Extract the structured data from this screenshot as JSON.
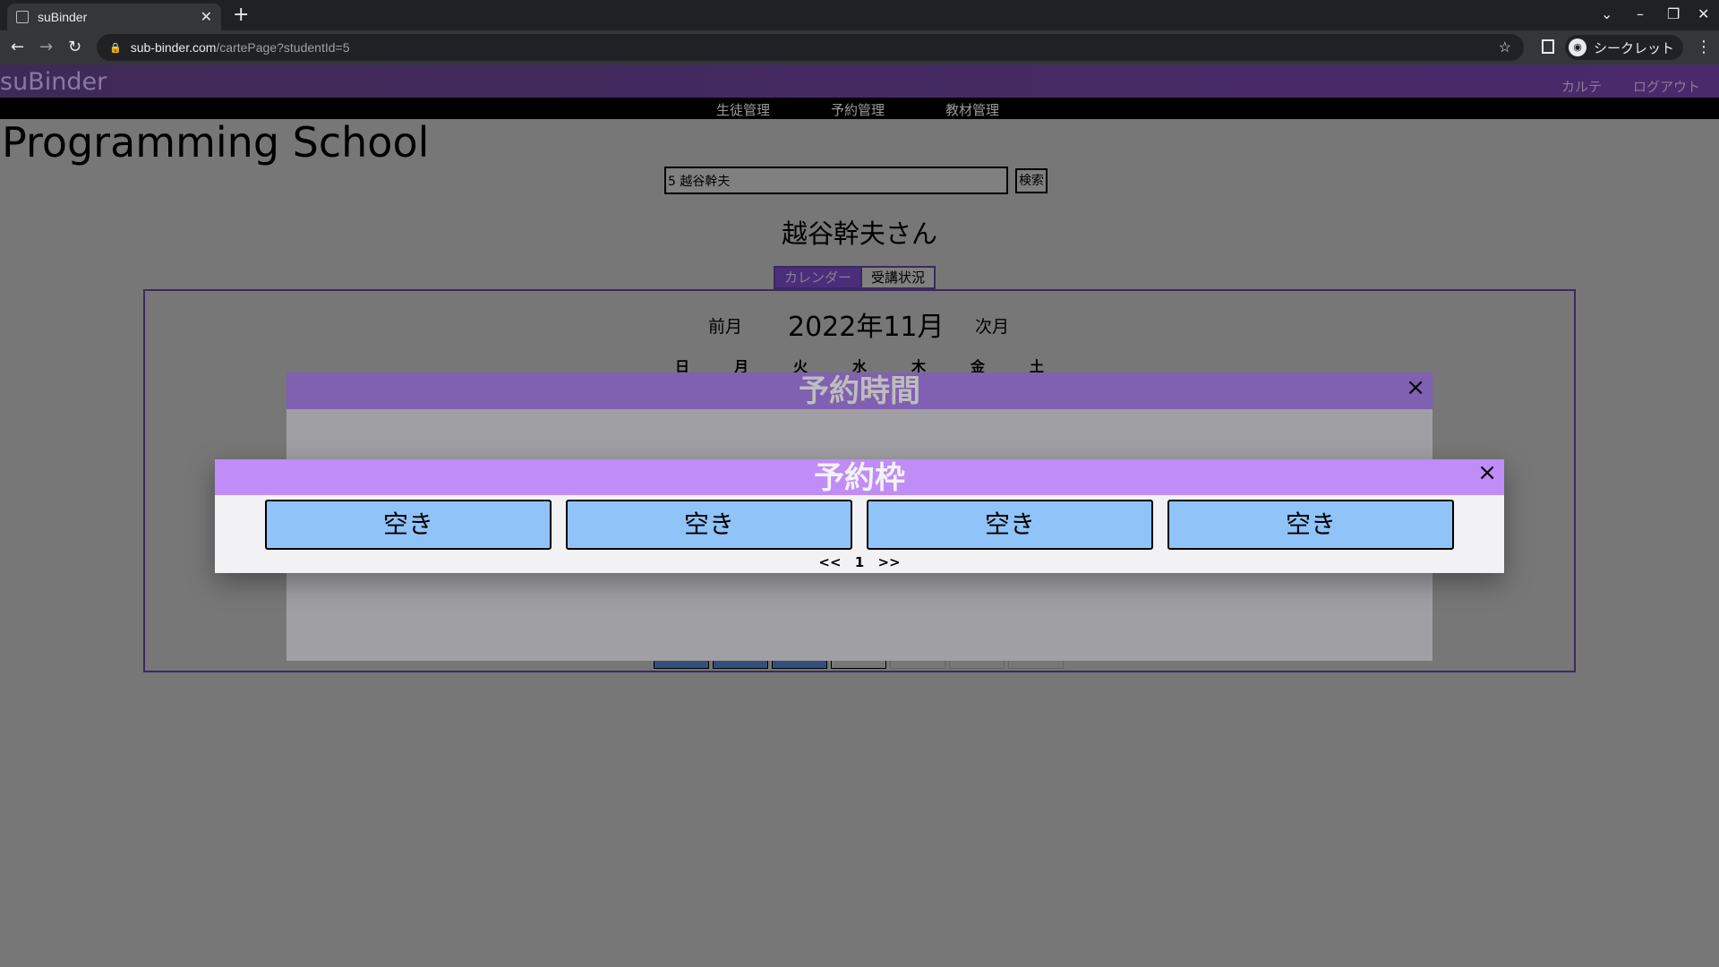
{
  "browser": {
    "tab_title": "suBinder",
    "url_host": "sub-binder.com",
    "url_path": "/cartePage?studentId=5",
    "incognito_label": "シークレット"
  },
  "app": {
    "brand": "suBinder",
    "header_links": {
      "karte": "カルテ",
      "logout": "ログアウト"
    },
    "menu": {
      "students": "生徒管理",
      "reservations": "予約管理",
      "materials": "教材管理"
    },
    "school_name": "Programming School",
    "search": {
      "value": "5 越谷幹夫",
      "button": "検索"
    },
    "student_name": "越谷幹夫さん",
    "tabs": {
      "calendar": "カレンダー",
      "status": "受講状況"
    },
    "calendar": {
      "prev": "前月",
      "month": "2022年11月",
      "next": "次月",
      "weekdays": [
        "日",
        "月",
        "火",
        "水",
        "木",
        "金",
        "土"
      ]
    }
  },
  "modal_time": {
    "title": "予約時間",
    "close": "×"
  },
  "modal_slot": {
    "title": "予約枠",
    "close": "×",
    "slots": [
      "空き",
      "空き",
      "空き",
      "空き"
    ],
    "pager": {
      "prev": "<<",
      "page": "1",
      "next": ">>"
    }
  }
}
